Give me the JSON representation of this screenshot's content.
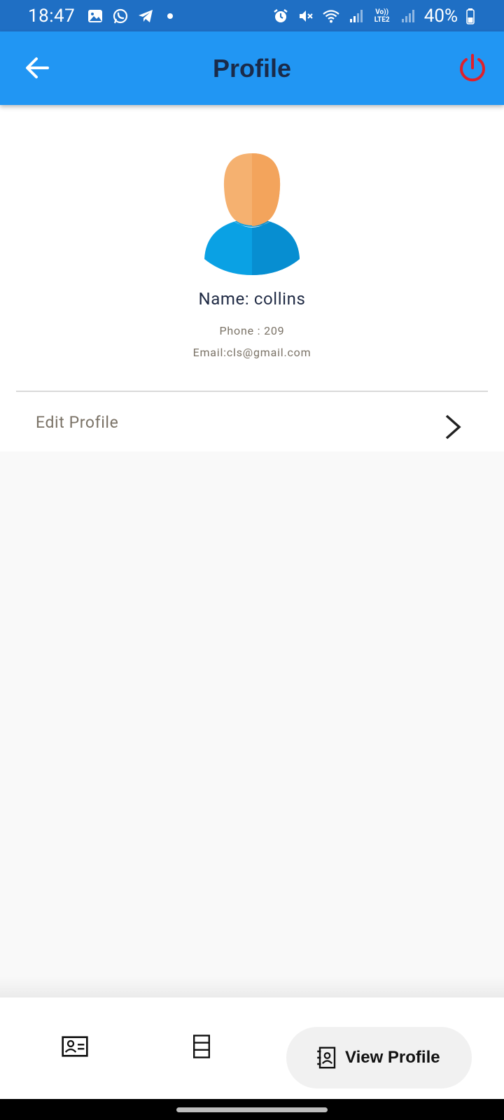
{
  "status_bar": {
    "time": "18:47",
    "battery": "40%",
    "left_icons": [
      "gallery-icon",
      "whatsapp-icon",
      "telegram-icon",
      "notification-dot"
    ],
    "right_icons": [
      "alarm-icon",
      "mute-icon",
      "wifi-icon",
      "signal-icon",
      "volte-lte2-icon",
      "signal-icon",
      "battery-icon"
    ],
    "volte_label": "Vo)) LTE2"
  },
  "app_bar": {
    "title": "Profile",
    "back_icon": "arrow-back-icon",
    "power_icon": "power-icon",
    "background": "#2196f3",
    "power_color": "#e0202a"
  },
  "profile": {
    "avatar_icon": "person-avatar-icon",
    "name": "Name: collins",
    "phone": "Phone : 209",
    "email": "Email:cls@gmail.com"
  },
  "menu": {
    "edit_profile_label": "Edit Profile",
    "edit_profile_icon": "chevron-right-icon"
  },
  "bottom_nav": {
    "items": [
      {
        "icon": "contact-card-icon",
        "label": ""
      },
      {
        "icon": "list-rows-icon",
        "label": ""
      },
      {
        "icon": "contact-book-icon",
        "label": "View Profile",
        "selected": true
      }
    ]
  }
}
